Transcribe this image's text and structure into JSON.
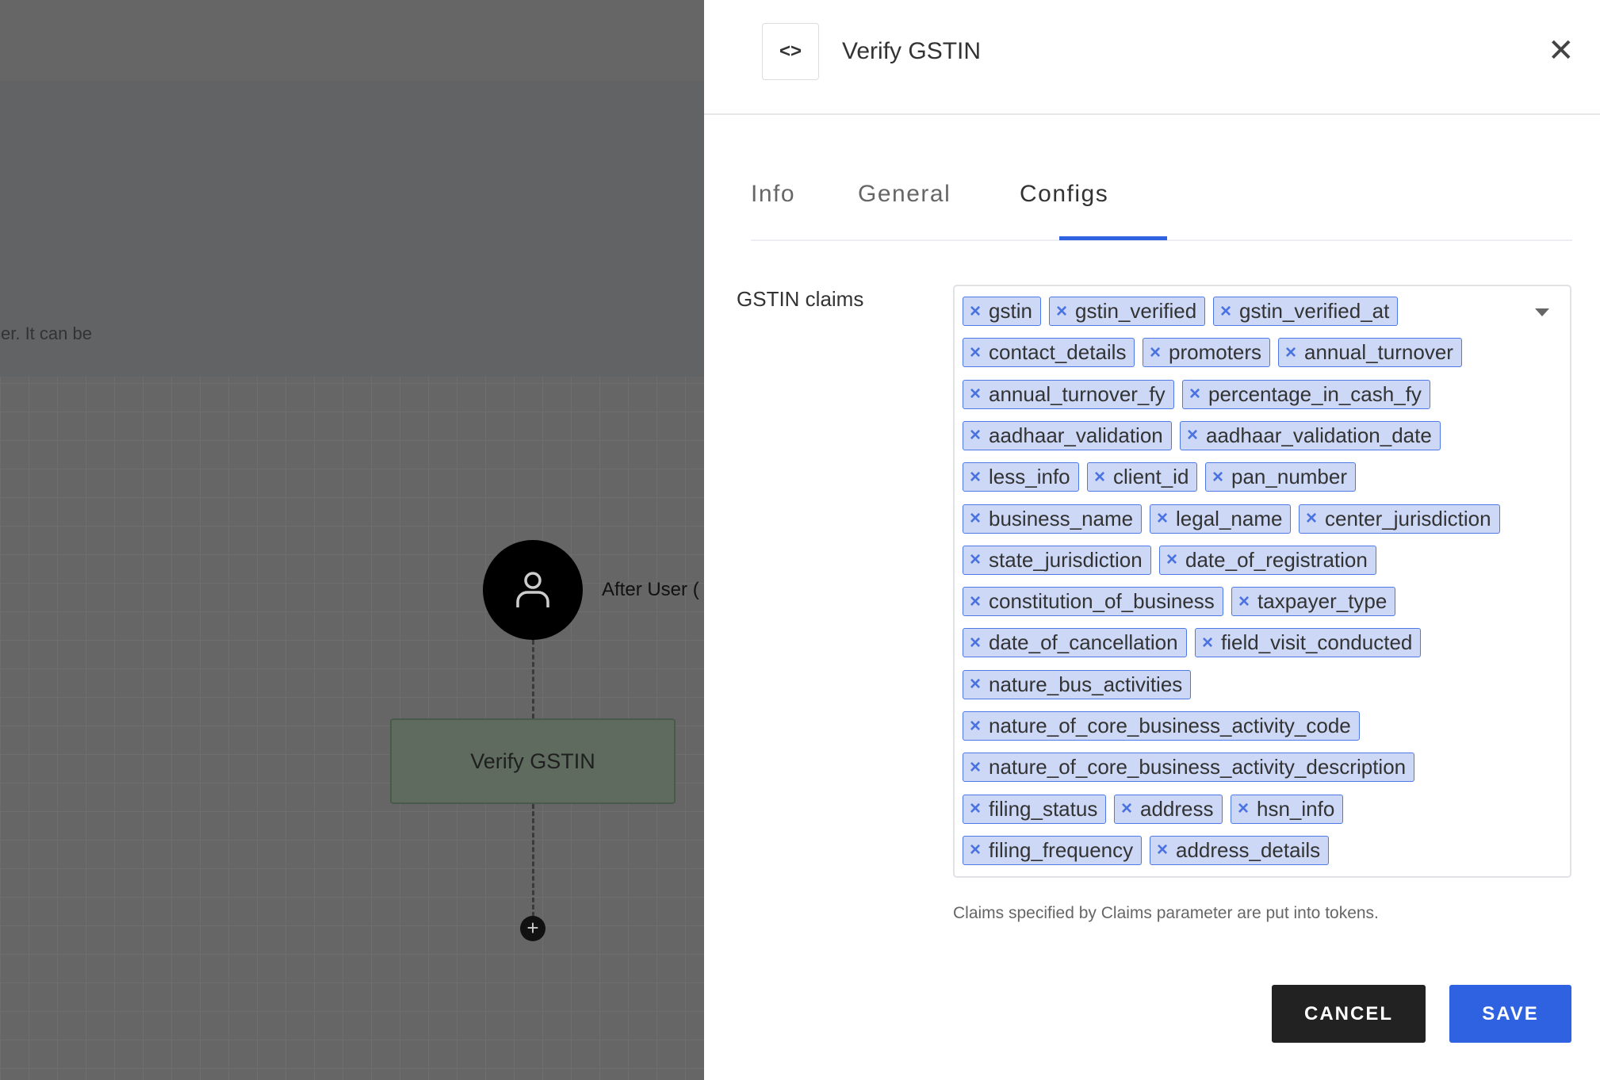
{
  "background": {
    "info_text": "ser. It can be",
    "node_label": "After User (",
    "step_label": "Verify GSTIN",
    "plus_icon": "+"
  },
  "panel": {
    "code_icon": "<>",
    "title": "Verify GSTIN",
    "close_icon": "✕",
    "tabs": [
      {
        "label": "Info"
      },
      {
        "label": "General"
      },
      {
        "label": "Configs",
        "active": true
      }
    ],
    "field_label": "GSTIN claims",
    "tag_remove_icon": "×",
    "claims": [
      "gstin",
      "gstin_verified",
      "gstin_verified_at",
      "contact_details",
      "promoters",
      "annual_turnover",
      "annual_turnover_fy",
      "percentage_in_cash_fy",
      "aadhaar_validation",
      "aadhaar_validation_date",
      "less_info",
      "client_id",
      "pan_number",
      "business_name",
      "legal_name",
      "center_jurisdiction",
      "state_jurisdiction",
      "date_of_registration",
      "constitution_of_business",
      "taxpayer_type",
      "date_of_cancellation",
      "field_visit_conducted",
      "nature_bus_activities",
      "nature_of_core_business_activity_code",
      "nature_of_core_business_activity_description",
      "filing_status",
      "address",
      "hsn_info",
      "filing_frequency",
      "address_details"
    ],
    "help_text": "Claims specified by Claims parameter are put into tokens.",
    "cancel_label": "CANCEL",
    "save_label": "SAVE",
    "accent_color": "#2f62e0"
  }
}
